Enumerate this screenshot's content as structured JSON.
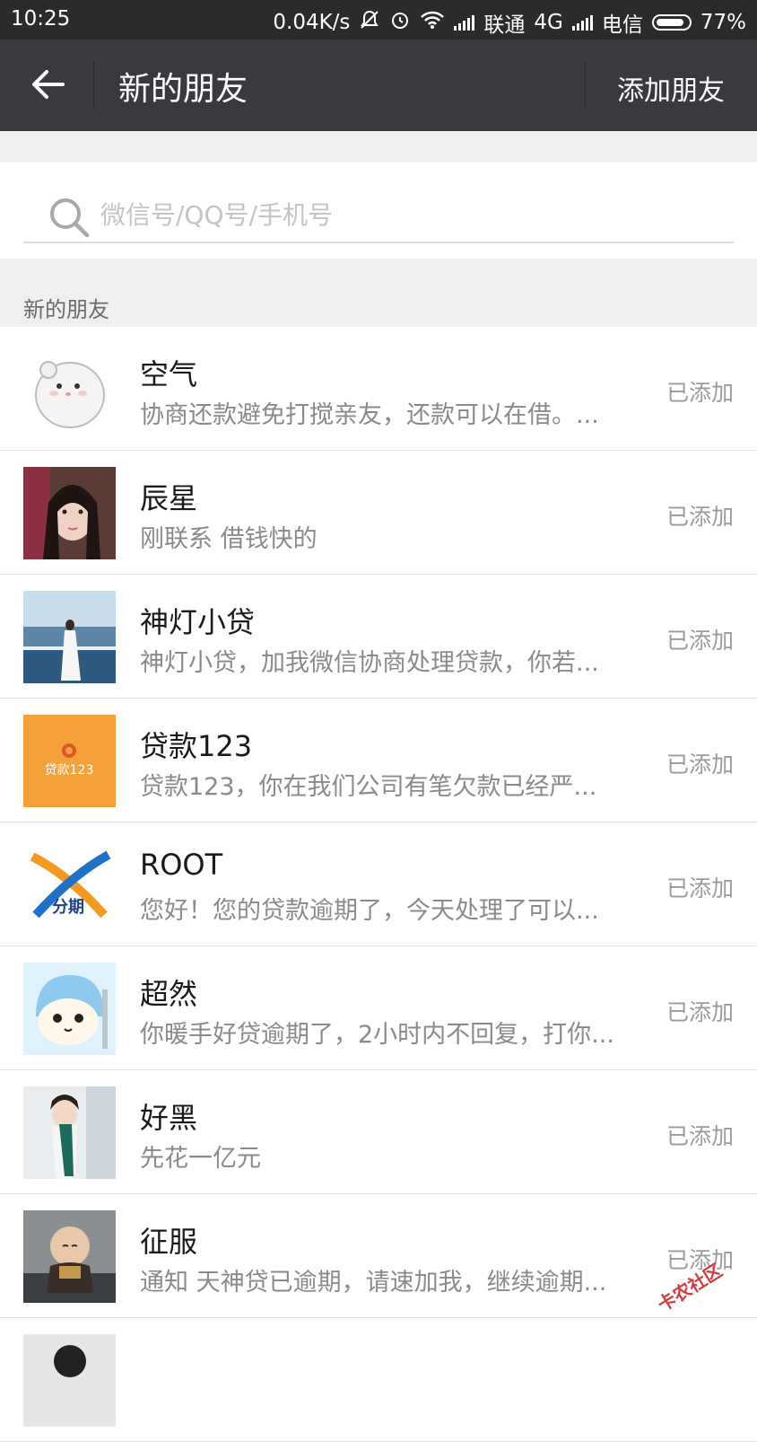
{
  "status_bar": {
    "time": "10:25",
    "net_speed": "0.04K/s",
    "carrier1": "联通",
    "network": "4G",
    "carrier2": "电信",
    "battery": "77%"
  },
  "header": {
    "title": "新的朋友",
    "add_friend": "添加朋友",
    "back_icon": "back-arrow-icon"
  },
  "search": {
    "placeholder": "微信号/QQ号/手机号",
    "value": ""
  },
  "section_label": "新的朋友",
  "friends": [
    {
      "name": "空气",
      "message": "协商还款避免打搅亲友，还款可以在借。...",
      "status": "已添加",
      "avatar": "hamster-avatar"
    },
    {
      "name": "辰星",
      "message": "刚联系 借钱快的",
      "status": "已添加",
      "avatar": "girl-photo-avatar"
    },
    {
      "name": "神灯小贷",
      "message": "神灯小贷，加我微信协商处理贷款，你若...",
      "status": "已添加",
      "avatar": "seaside-photo-avatar"
    },
    {
      "name": "贷款123",
      "message": "贷款123，你在我们公司有笔欠款已经严...",
      "status": "已添加",
      "avatar": "loan123-logo-avatar",
      "avatar_text": "贷款123"
    },
    {
      "name": "ROOT",
      "message": "您好！您的贷款逾期了，今天处理了可以...",
      "status": "已添加",
      "avatar": "fenqi-logo-avatar",
      "avatar_text": "分期"
    },
    {
      "name": "超然",
      "message": "你暖手好贷逾期了，2小时内不回复，打你...",
      "status": "已添加",
      "avatar": "cartoon-cat-avatar"
    },
    {
      "name": "好黑",
      "message": "先花一亿元",
      "status": "已添加",
      "avatar": "scarf-girl-avatar"
    },
    {
      "name": "征服",
      "message": "通知  天神贷已逾期，请速加我，继续逾期...",
      "status": "已添加",
      "avatar": "monk-figure-avatar"
    },
    {
      "name": "",
      "message": "",
      "status": "",
      "avatar": "partial-avatar"
    }
  ],
  "watermark": "卡农社区",
  "colors": {
    "header_bg": "#393a3f",
    "status_bar_bg": "#2b2b2b",
    "page_bg": "#efefef"
  }
}
